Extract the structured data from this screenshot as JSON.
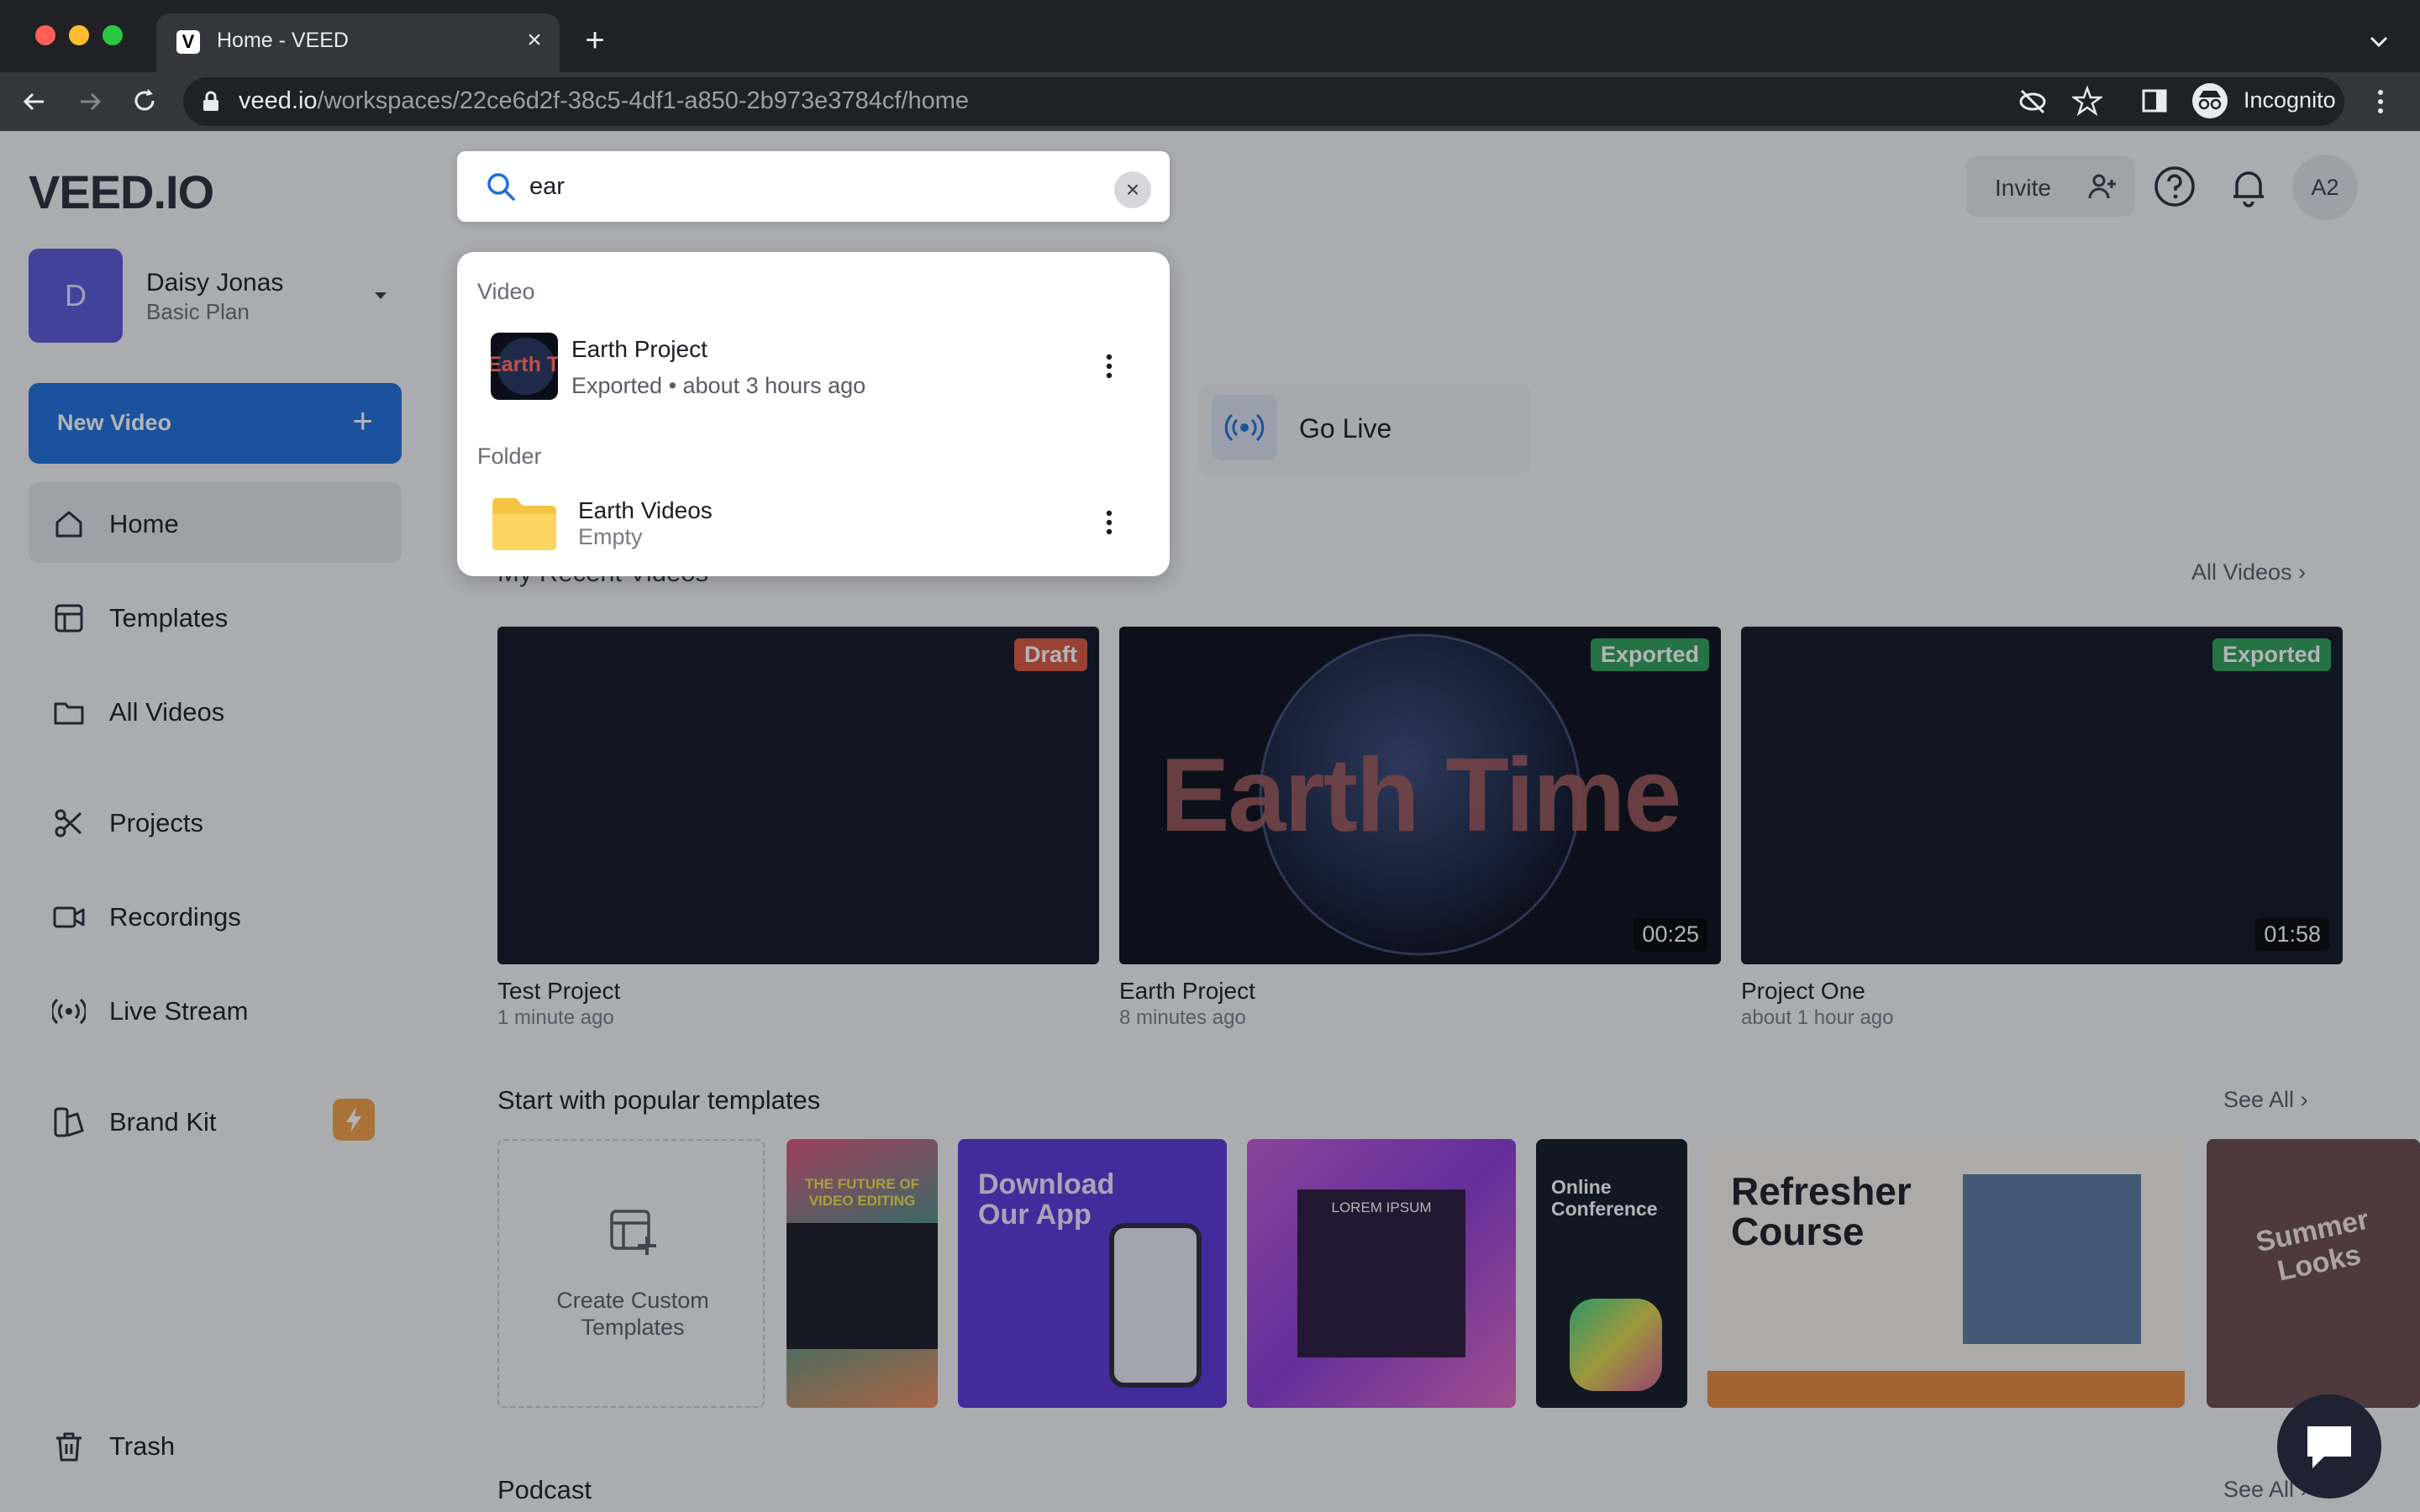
{
  "browser": {
    "tab_title": "Home - VEED",
    "tab_favicon": "V",
    "url_host": "veed.io",
    "url_path": "/workspaces/22ce6d2f-38c5-4df1-a850-2b973e3784cf/home",
    "incognito_label": "Incognito"
  },
  "sidebar": {
    "logo": "VEED.IO",
    "user": {
      "initial": "D",
      "name": "Daisy Jonas",
      "plan": "Basic Plan"
    },
    "new_video_label": "New Video",
    "nav": {
      "home": "Home",
      "templates": "Templates",
      "all_videos": "All Videos",
      "projects": "Projects",
      "recordings": "Recordings",
      "live_stream": "Live Stream",
      "brand_kit": "Brand Kit",
      "trash": "Trash"
    }
  },
  "header": {
    "invite_label": "Invite",
    "avatar_initials": "A2"
  },
  "main": {
    "go_live_label": "Go Live",
    "recent_section_title": "My Recent Videos",
    "all_videos_link": "All Videos",
    "videos": [
      {
        "title": "Test Project",
        "time": "1 minute ago",
        "status": "Draft",
        "duration": ""
      },
      {
        "title": "Earth Project",
        "time": "8 minutes ago",
        "status": "Exported",
        "duration": "00:25",
        "overlay_text": "Earth Time"
      },
      {
        "title": "Project One",
        "time": "about 1 hour ago",
        "status": "Exported",
        "duration": "01:58"
      }
    ],
    "templates_section_title": "Start with popular templates",
    "see_all_label": "See All",
    "templates": {
      "create_custom": "Create Custom Templates",
      "t1_text": "THE FUTURE OF VIDEO EDITING",
      "t2_title": "Download Our App",
      "t3_text": "LOREM IPSUM",
      "t4_title": "Online Conference",
      "t5_title": "Refresher Course",
      "t6_text": "Summer Looks"
    },
    "podcast_section_title": "Podcast"
  },
  "search": {
    "query": "ear",
    "video_group_label": "Video",
    "folder_group_label": "Folder",
    "video_result": {
      "title": "Earth Project",
      "subtitle": "Exported • about 3 hours ago",
      "thumb_text": "Earth Time"
    },
    "folder_result": {
      "title": "Earth Videos",
      "subtitle": "Empty"
    }
  },
  "colors": {
    "accent": "#1e6fd9",
    "draft_badge": "#d9573f",
    "exported_badge": "#2f9e58",
    "brand_kit_badge": "#f0a045"
  },
  "icons": [
    "search-icon",
    "clear-icon",
    "kebab-icon",
    "folder-icon",
    "home-icon",
    "templates-icon",
    "folder-icon",
    "scissors-icon",
    "camera-icon",
    "broadcast-icon",
    "palette-icon",
    "trash-icon",
    "help-icon",
    "bell-icon",
    "add-user-icon",
    "chat-icon"
  ]
}
